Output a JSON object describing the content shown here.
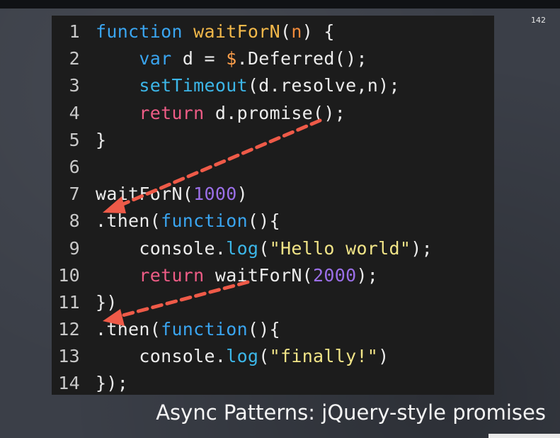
{
  "slide": {
    "number": "142",
    "caption": "Async Patterns: jQuery-style promises"
  },
  "colors": {
    "background": "#3b3f48",
    "code_background": "#1c1c1c",
    "keyword_function": "#3aa5f0",
    "identifier_function": "#f2b84a",
    "param": "#f08a3a",
    "number": "#9b6fe8",
    "string": "#f1e487",
    "return_keyword": "#ee5c86",
    "method": "#3cb6e8",
    "arrow": "#ee5a48"
  },
  "code": {
    "lines": [
      {
        "num": "1",
        "tokens": [
          {
            "t": "function",
            "c": "kw"
          },
          {
            "t": " ",
            "c": "plain"
          },
          {
            "t": "waitForN",
            "c": "fn"
          },
          {
            "t": "(",
            "c": "plain"
          },
          {
            "t": "n",
            "c": "pm"
          },
          {
            "t": ") {",
            "c": "plain"
          }
        ]
      },
      {
        "num": "2",
        "tokens": [
          {
            "t": "    ",
            "c": "plain"
          },
          {
            "t": "var",
            "c": "kw"
          },
          {
            "t": " d = ",
            "c": "plain"
          },
          {
            "t": "$",
            "c": "sym"
          },
          {
            "t": ".Deferred();",
            "c": "plain"
          }
        ]
      },
      {
        "num": "3",
        "tokens": [
          {
            "t": "    ",
            "c": "plain"
          },
          {
            "t": "setTimeout",
            "c": "cyan"
          },
          {
            "t": "(d.resolve,n);",
            "c": "plain"
          }
        ]
      },
      {
        "num": "4",
        "tokens": [
          {
            "t": "    ",
            "c": "plain"
          },
          {
            "t": "return",
            "c": "pink"
          },
          {
            "t": " d.promise();",
            "c": "plain"
          }
        ]
      },
      {
        "num": "5",
        "tokens": [
          {
            "t": "}",
            "c": "plain"
          }
        ]
      },
      {
        "num": "6",
        "tokens": [
          {
            "t": "",
            "c": "plain"
          }
        ]
      },
      {
        "num": "7",
        "tokens": [
          {
            "t": "waitForN(",
            "c": "plain"
          },
          {
            "t": "1000",
            "c": "num"
          },
          {
            "t": ")",
            "c": "plain"
          }
        ]
      },
      {
        "num": "8",
        "tokens": [
          {
            "t": ".then(",
            "c": "plain"
          },
          {
            "t": "function",
            "c": "kw"
          },
          {
            "t": "(){",
            "c": "plain"
          }
        ]
      },
      {
        "num": "9",
        "tokens": [
          {
            "t": "    console.",
            "c": "plain"
          },
          {
            "t": "log",
            "c": "cyan"
          },
          {
            "t": "(",
            "c": "plain"
          },
          {
            "t": "\"Hello world\"",
            "c": "str"
          },
          {
            "t": ");",
            "c": "plain"
          }
        ]
      },
      {
        "num": "10",
        "tokens": [
          {
            "t": "    ",
            "c": "plain"
          },
          {
            "t": "return",
            "c": "pink"
          },
          {
            "t": " waitForN(",
            "c": "plain"
          },
          {
            "t": "2000",
            "c": "num"
          },
          {
            "t": ");",
            "c": "plain"
          }
        ]
      },
      {
        "num": "11",
        "tokens": [
          {
            "t": "})",
            "c": "plain"
          }
        ]
      },
      {
        "num": "12",
        "tokens": [
          {
            "t": ".then(",
            "c": "plain"
          },
          {
            "t": "function",
            "c": "kw"
          },
          {
            "t": "(){",
            "c": "plain"
          }
        ]
      },
      {
        "num": "13",
        "tokens": [
          {
            "t": "    console.",
            "c": "plain"
          },
          {
            "t": "log",
            "c": "cyan"
          },
          {
            "t": "(",
            "c": "plain"
          },
          {
            "t": "\"finally!\"",
            "c": "str"
          },
          {
            "t": ")",
            "c": "plain"
          }
        ]
      },
      {
        "num": "14",
        "tokens": [
          {
            "t": "});",
            "c": "plain"
          }
        ]
      }
    ]
  }
}
